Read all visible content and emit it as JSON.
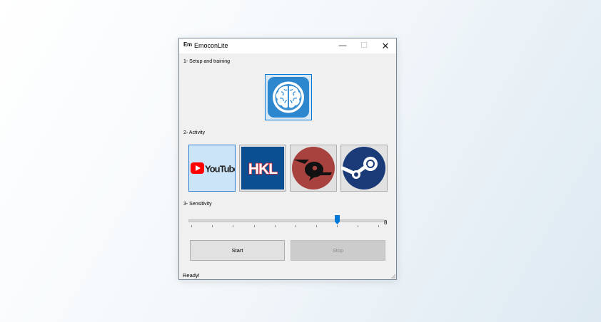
{
  "window": {
    "app_icon_text": "Em",
    "title": "EmoconLite",
    "minimize_glyph": "—",
    "maximize_glyph": "☐",
    "close_glyph": "✕"
  },
  "sections": {
    "setup_label": "1- Setup and training",
    "activity_label": "2- Activity",
    "sensitivity_label": "3- Sensitivity"
  },
  "setup_tile": {
    "icon": "brain-icon"
  },
  "activity_tiles": [
    {
      "icon": "youtube-logo",
      "logo_text": "YouTube",
      "selected": true
    },
    {
      "icon": "hkl-logo",
      "logo_text": "HKL",
      "selected": false
    },
    {
      "icon": "game-helmet-logo",
      "selected": false
    },
    {
      "icon": "steam-logo",
      "selected": false
    }
  ],
  "slider": {
    "value": "8",
    "min": 0,
    "max": 10,
    "level": 8
  },
  "buttons": {
    "start": "Start",
    "stop": "Stop",
    "stop_disabled": true
  },
  "status": "Ready!",
  "colors": {
    "accent": "#0078d7",
    "brain_bg": "#2d87cf",
    "youtube_red": "#ff0000",
    "hkl_blue": "#0b4f93",
    "helmet_circle": "#a8423f",
    "steam_blue": "#1a3b78"
  }
}
